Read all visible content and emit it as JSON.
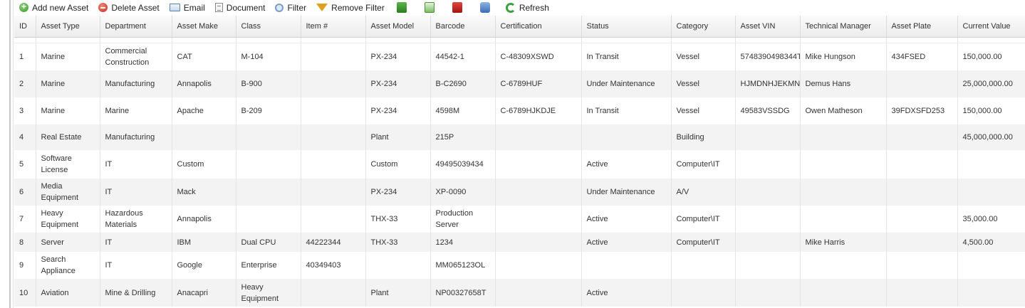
{
  "toolbar": {
    "add": "Add new Asset",
    "delete": "Delete Asset",
    "email": "Email",
    "document": "Document",
    "filter": "Filter",
    "remove_filter": "Remove Filter",
    "refresh": "Refresh",
    "export_icons": [
      "export-excel-icon",
      "excel-icon",
      "pdf-icon",
      "save-icon"
    ]
  },
  "grid": {
    "columns": [
      "ID",
      "Asset Type",
      "Department",
      "Asset Make",
      "Class",
      "Item #",
      "Asset Model",
      "Barcode",
      "Certification",
      "Status",
      "Category",
      "Asset VIN",
      "Technical Manager",
      "Asset Plate",
      "Current Value"
    ],
    "rows": [
      [
        "1",
        "Marine",
        "Commercial Construction",
        "CAT",
        "M-104",
        "",
        "PX-234",
        "44542-1",
        "C-48309XSWD",
        "In Transit",
        "Vessel",
        "5748390498344T",
        "Mike Hungson",
        "434FSED",
        "150,000.00"
      ],
      [
        "2",
        "Marine",
        "Manufacturing",
        "Annapolis",
        "B-900",
        "",
        "PX-234",
        "B-C2690",
        "C-6789HUF",
        "Under Maintenance",
        "Vessel",
        "HJMDNHJEKMN",
        "Demus Hans",
        "",
        "25,000,000.00"
      ],
      [
        "3",
        "Marine",
        "Marine",
        "Apache",
        "B-209",
        "",
        "PX-234",
        "4598M",
        "C-6789HJKDJE",
        "In Transit",
        "Vessel",
        "49583VSSDG",
        "Owen Matheson",
        "39FDXSFD253",
        "150,000.00"
      ],
      [
        "4",
        "Real Estate",
        "Manufacturing",
        "",
        "",
        "",
        "Plant",
        "215P",
        "",
        "",
        "Building",
        "",
        "",
        "",
        "45,000,000.00"
      ],
      [
        "5",
        "Software License",
        "IT",
        "Custom",
        "",
        "",
        "Custom",
        "49495039434",
        "",
        "Active",
        "Computer\\IT",
        "",
        "",
        "",
        ""
      ],
      [
        "6",
        "Media Equipment",
        "IT",
        "Mack",
        "",
        "",
        "PX-234",
        "XP-0090",
        "",
        "Under Maintenance",
        "A/V",
        "",
        "",
        "",
        ""
      ],
      [
        "7",
        "Heavy Equipment",
        "Hazardous Materials",
        "Annapolis",
        "",
        "",
        "THX-33",
        "Production Server",
        "",
        "Active",
        "Computer\\IT",
        "",
        "",
        "",
        "35,000.00"
      ],
      [
        "8",
        "Server",
        "IT",
        "IBM",
        "Dual CPU",
        "44222344",
        "THX-33",
        "1234",
        "",
        "Active",
        "Computer\\IT",
        "",
        "Mike Harris",
        "",
        "4,500.00"
      ],
      [
        "9",
        "Search Appliance",
        "IT",
        "Google",
        "Enterprise",
        "40349403",
        "",
        "MM065123OL",
        "",
        "",
        "",
        "",
        "",
        "",
        ""
      ],
      [
        "10",
        "Aviation",
        "Mine & Drilling",
        "Anacapri",
        "Heavy Equipment",
        "",
        "Plant",
        "NP00327658T",
        "",
        "Active",
        "",
        "",
        "",
        "",
        ""
      ]
    ]
  }
}
